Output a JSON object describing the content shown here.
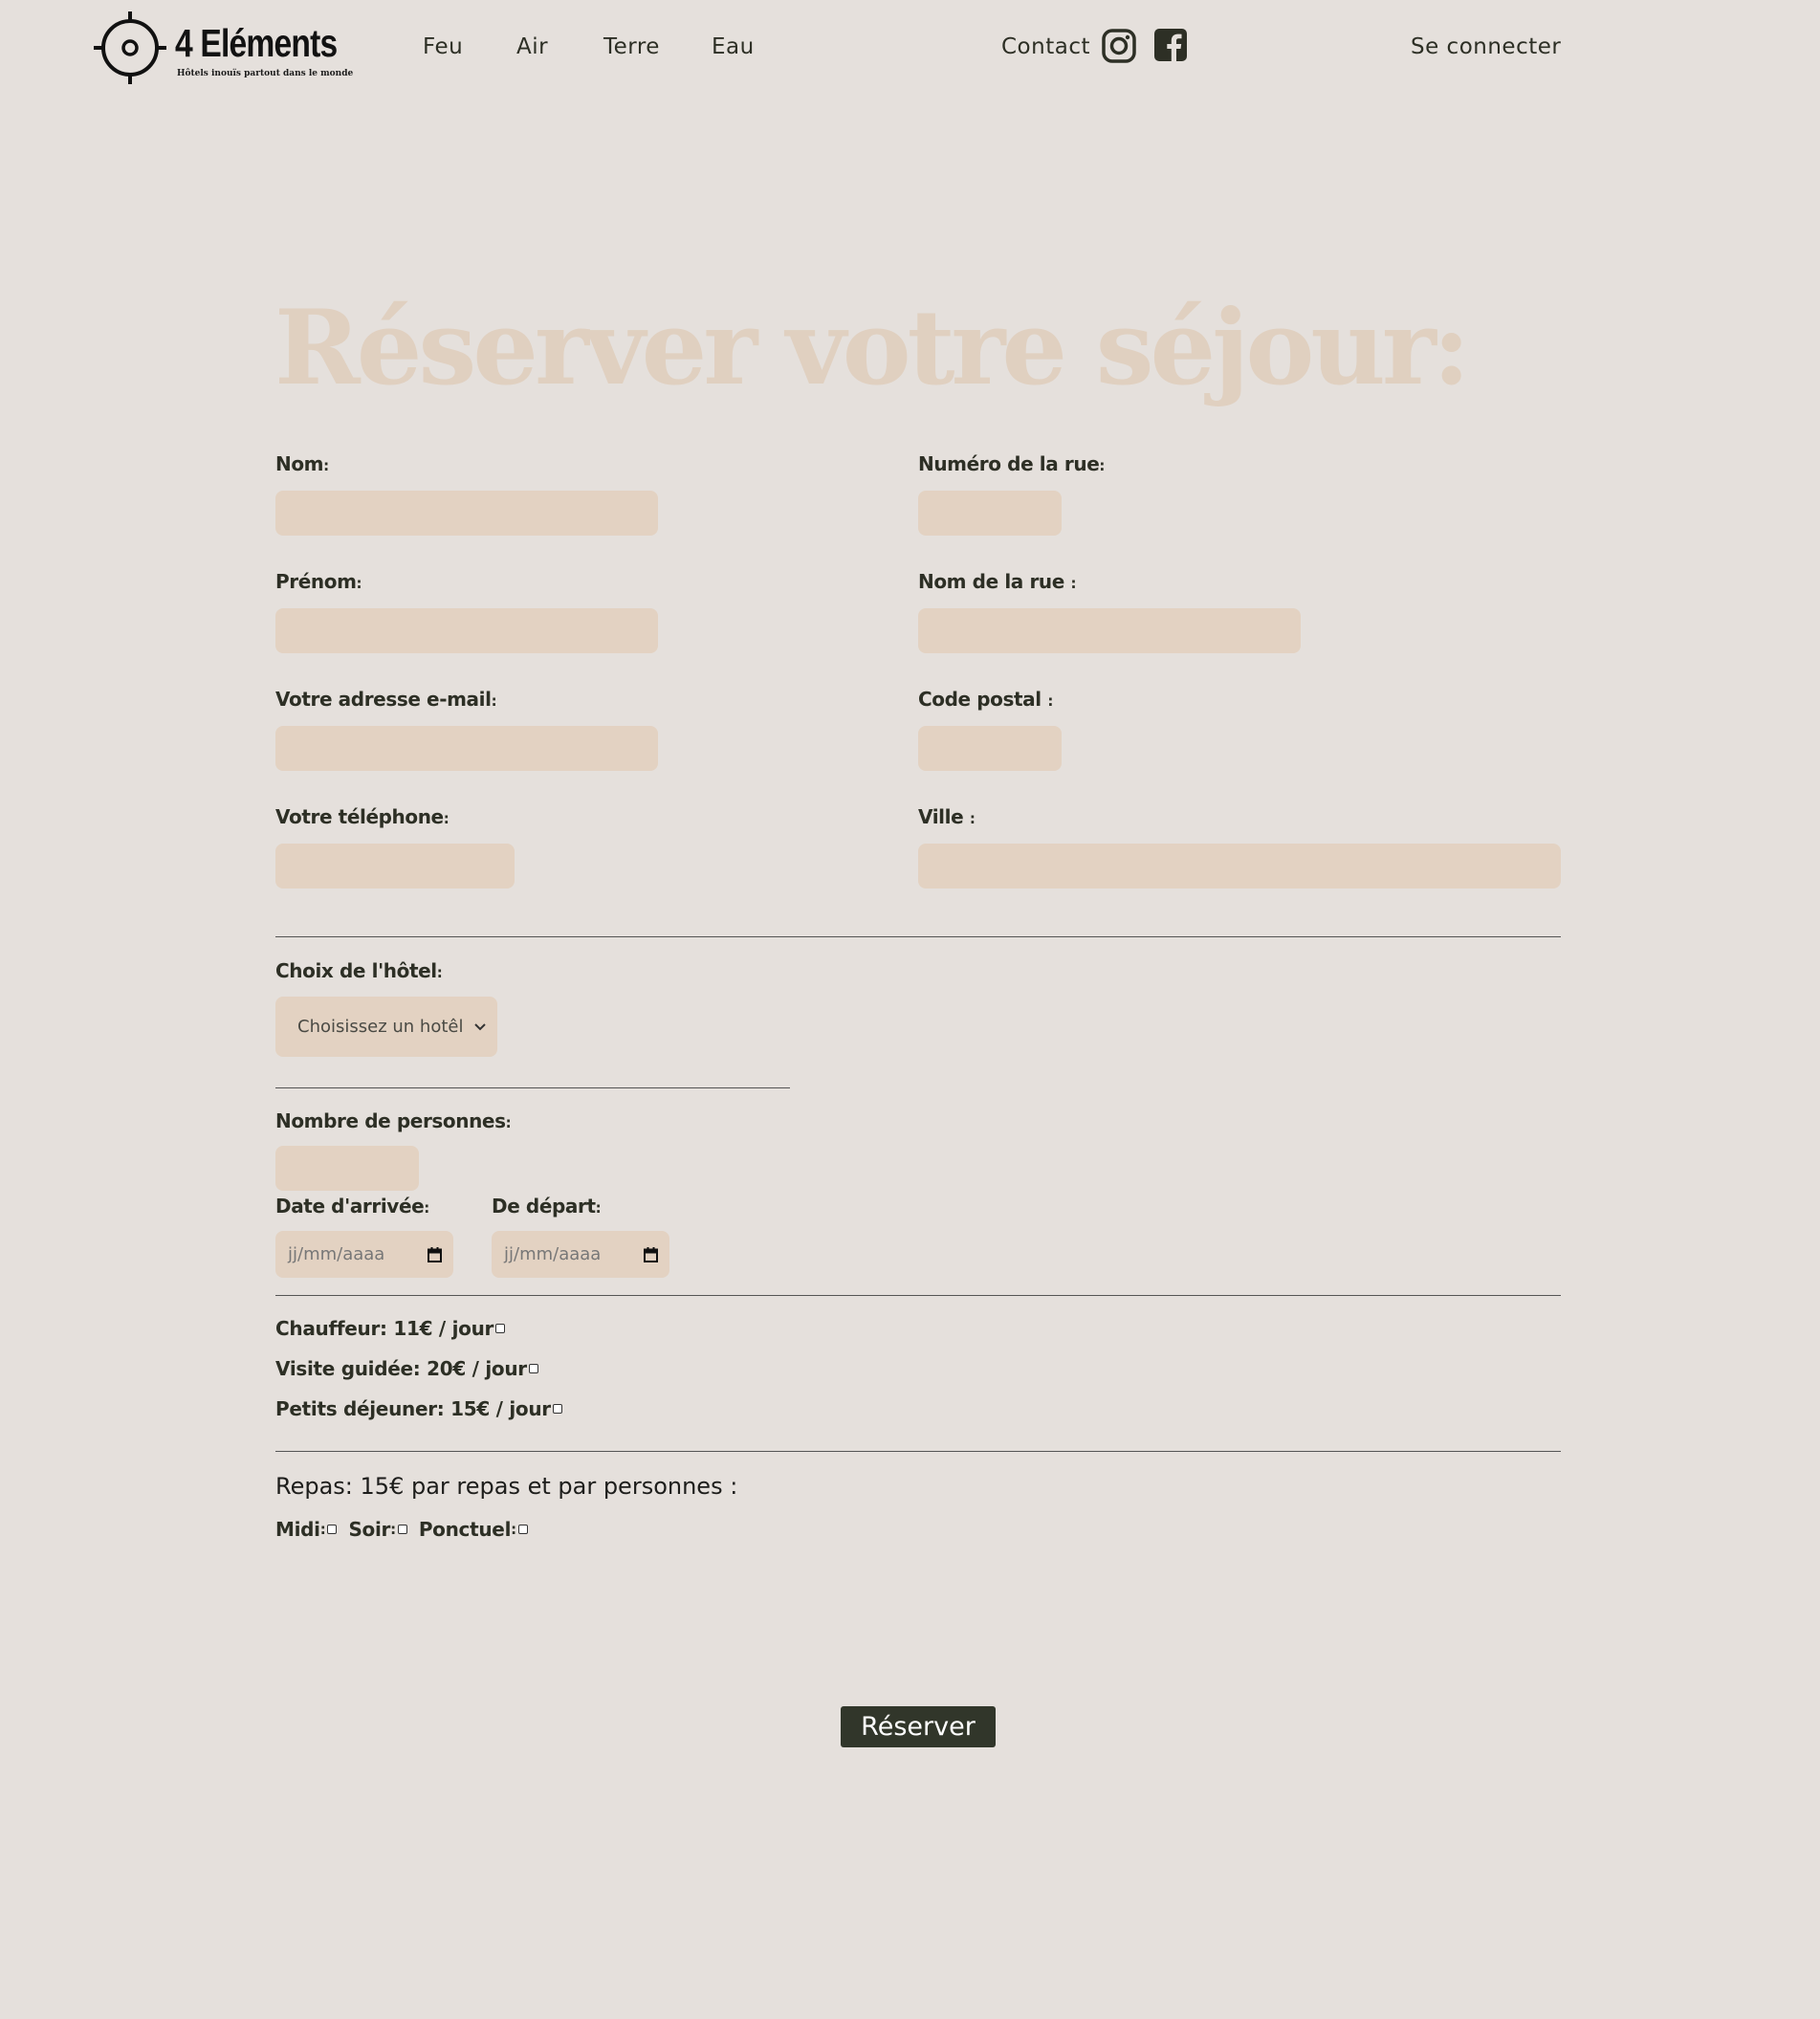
{
  "header": {
    "logo_text": "4 Eléments",
    "logo_tagline": "Hôtels inouïs partout dans le monde",
    "nav": [
      "Feu",
      "Air",
      "Terre",
      "Eau"
    ],
    "contact": "Contact",
    "login": "Se connecter",
    "icons": [
      "instagram-icon",
      "facebook-icon"
    ]
  },
  "form": {
    "title": "Réserver votre séjour:",
    "left_fields": [
      {
        "label": "Nom",
        "suffix": ":"
      },
      {
        "label": "Prénom",
        "suffix": ":"
      },
      {
        "label": "Votre adresse e-mail",
        "suffix": ":"
      },
      {
        "label": "Votre téléphone",
        "suffix": ":"
      }
    ],
    "right_fields": [
      {
        "label": "Numéro de la rue",
        "suffix": ":"
      },
      {
        "label": "Nom de la rue ",
        "suffix": ":"
      },
      {
        "label": "Code postal ",
        "suffix": ":"
      },
      {
        "label": "Ville ",
        "suffix": ":"
      }
    ],
    "hotel": {
      "label": "Choix de l'hôtel",
      "suffix": ":",
      "selected": "Choisissez un hotêl"
    },
    "persons": {
      "label": "Nombre de personnes",
      "suffix": ":"
    },
    "arrival": {
      "label": "Date d'arrivée",
      "suffix": ":",
      "placeholder": "jj/mm/aaaa"
    },
    "departure": {
      "label": "De départ",
      "suffix": ":",
      "placeholder": "jj/mm/aaaa"
    },
    "options": [
      {
        "label": "Chauffeur",
        "price": ": 11€ / jour"
      },
      {
        "label": "Visite guidée",
        "price": ": 20€ / jour"
      },
      {
        "label": "Petits déjeuner",
        "price": ": 15€ / jour"
      }
    ],
    "meals": {
      "title": "Repas: 15€ par repas et par personnes :",
      "items": [
        {
          "label": "Midi",
          "suffix": ":"
        },
        {
          "label": "Soir",
          "suffix": ":"
        },
        {
          "label": "Ponctuel",
          "suffix": ":"
        }
      ]
    },
    "submit_label": "Réserver"
  },
  "colors": {
    "background": "#e5e0dc",
    "field": "#e3d2c2",
    "title": "#e0d0c0",
    "text": "#2d2f25",
    "button": "#31362a"
  }
}
